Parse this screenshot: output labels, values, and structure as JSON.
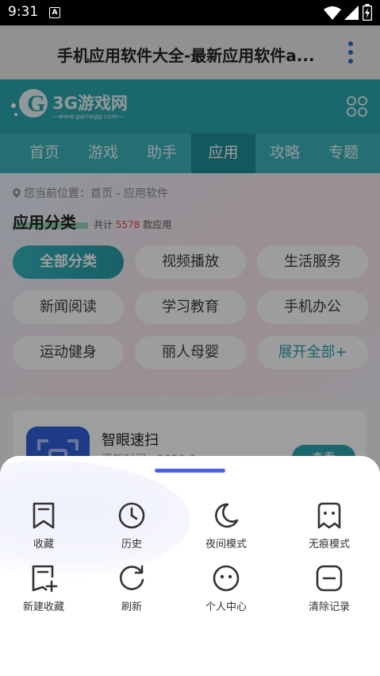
{
  "status_bar": {
    "time": "9:31",
    "notification_icon": "a-icon",
    "icons": [
      "wifi-icon",
      "signal-icon",
      "battery-icon"
    ]
  },
  "browser": {
    "title": "手机应用软件大全-最新应用软件a...",
    "more_icon": "more-vertical-icon"
  },
  "site": {
    "logo_text": "3G游戏网",
    "logo_url": "—www.gamegg.com—",
    "nav": [
      "首页",
      "游戏",
      "助手",
      "应用",
      "攻略",
      "专题"
    ],
    "nav_active": "应用"
  },
  "content": {
    "breadcrumb": "您当前位置：首页 - 应用软件",
    "category_title": "应用分类",
    "total_prefix": "共计",
    "total_count": "5578",
    "total_suffix": "款应用",
    "categories": [
      "全部分类",
      "视频播放",
      "生活服务",
      "新闻阅读",
      "学习教育",
      "手机办公",
      "运动健身",
      "丽人母婴",
      "展开全部+"
    ]
  },
  "list": {
    "app_name": "智眼速扫",
    "app_sub": "更新时间：2023-0...",
    "view_button": "查看"
  },
  "menu": {
    "items": [
      {
        "label": "收藏",
        "icon": "bookmark-icon"
      },
      {
        "label": "历史",
        "icon": "clock-icon"
      },
      {
        "label": "夜间模式",
        "icon": "moon-icon"
      },
      {
        "label": "无痕模式",
        "icon": "ghost-icon"
      },
      {
        "label": "新建收藏",
        "icon": "bookmark-add-icon"
      },
      {
        "label": "刷新",
        "icon": "refresh-icon"
      },
      {
        "label": "个人中心",
        "icon": "face-icon"
      },
      {
        "label": "清除记录",
        "icon": "clear-icon"
      }
    ]
  },
  "colors": {
    "accent": "#2aa6b0",
    "handle": "#4a63e6",
    "count_red": "#ee4a3b"
  }
}
